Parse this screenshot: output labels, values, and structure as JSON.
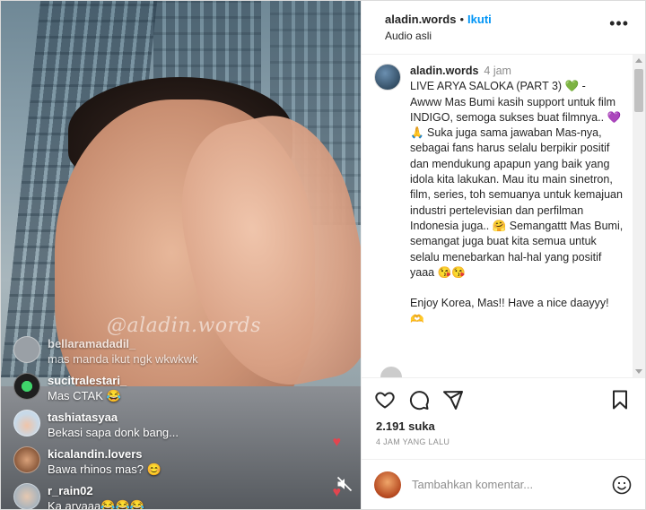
{
  "video": {
    "watermark": "@aladin.words",
    "live_comments": [
      {
        "username": "bellaramadadil_",
        "message": "mas manda ikut ngk wkwkwk",
        "avatar_color": "#9aa0a6",
        "faded": true
      },
      {
        "username": "sucitralestari_",
        "message": "Mas CTAK 😂",
        "avatar_color": "#1f1f1f"
      },
      {
        "username": "tashiatasyaa",
        "message": "Bekasi sapa donk bang...",
        "avatar_color": "#c8d9e8"
      },
      {
        "username": "kicalandin.lovers",
        "message": "Bawa rhinos mas? 😊",
        "avatar_color": "#8b5a3c"
      },
      {
        "username": "r_rain02",
        "message": "Ka aryaaa😂😂😂",
        "avatar_color": "#a7b3bd"
      }
    ]
  },
  "post": {
    "header": {
      "username": "aladin.words",
      "separator": "•",
      "follow_label": "Ikuti",
      "audio_label": "Audio asli",
      "more_label": "•••"
    },
    "caption": {
      "username": "aladin.words",
      "time": "4 jam",
      "text": "LIVE ARYA SALOKA (PART 3) 💚 -\nAwww Mas Bumi kasih support untuk film INDIGO, semoga sukses buat filmnya.. 💜🙏 Suka juga sama jawaban Mas-nya, sebagai fans harus selalu berpikir positif dan mendukung apapun yang baik yang idola kita lakukan. Mau itu main sinetron, film, series, toh semuanya untuk kemajuan industri pertelevisian dan perfilman Indonesia juga.. 🤗 Semangattt Mas Bumi, semangat juga buat kita semua untuk selalu menebarkan hal-hal yang positif yaaa 😘😘\n\nEnjoy Korea, Mas!! Have a nice daayyy! 🫶"
    },
    "likes": "2.191 suka",
    "time_ago": "4 JAM YANG LALU",
    "comment_placeholder": "Tambahkan komentar..."
  },
  "colors": {
    "accent": "#0095f6",
    "muted": "#8e8e8e",
    "heart": "#e2454f"
  }
}
